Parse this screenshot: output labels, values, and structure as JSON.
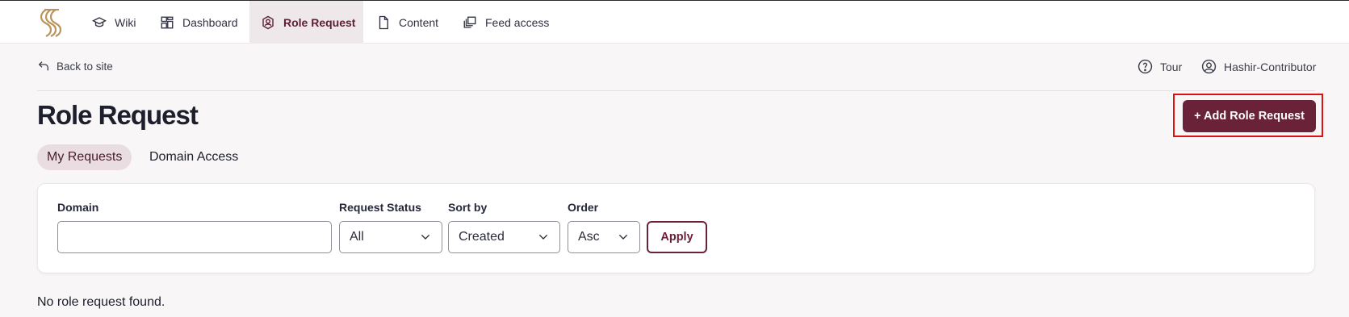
{
  "nav": {
    "items": [
      {
        "label": "Wiki",
        "icon": "graduation-cap-icon"
      },
      {
        "label": "Dashboard",
        "icon": "dashboard-icon"
      },
      {
        "label": "Role Request",
        "icon": "role-badge-icon",
        "active": true
      },
      {
        "label": "Content",
        "icon": "document-icon"
      },
      {
        "label": "Feed access",
        "icon": "feed-icon"
      }
    ]
  },
  "subheader": {
    "back_label": "Back to site",
    "tour_label": "Tour",
    "user_label": "Hashir-Contributor"
  },
  "page": {
    "title": "Role Request",
    "add_button_label": "+ Add Role Request"
  },
  "tabs": [
    {
      "label": "My Requests",
      "active": true
    },
    {
      "label": "Domain Access",
      "active": false
    }
  ],
  "filters": {
    "domain": {
      "label": "Domain",
      "value": ""
    },
    "status": {
      "label": "Request Status",
      "value": "All"
    },
    "sort": {
      "label": "Sort by",
      "value": "Created"
    },
    "order": {
      "label": "Order",
      "value": "Asc"
    },
    "apply_label": "Apply"
  },
  "empty_message": "No role request found.",
  "colors": {
    "accent": "#6a2238",
    "highlight": "#e11010",
    "active_tab_bg": "#e9dde1"
  }
}
